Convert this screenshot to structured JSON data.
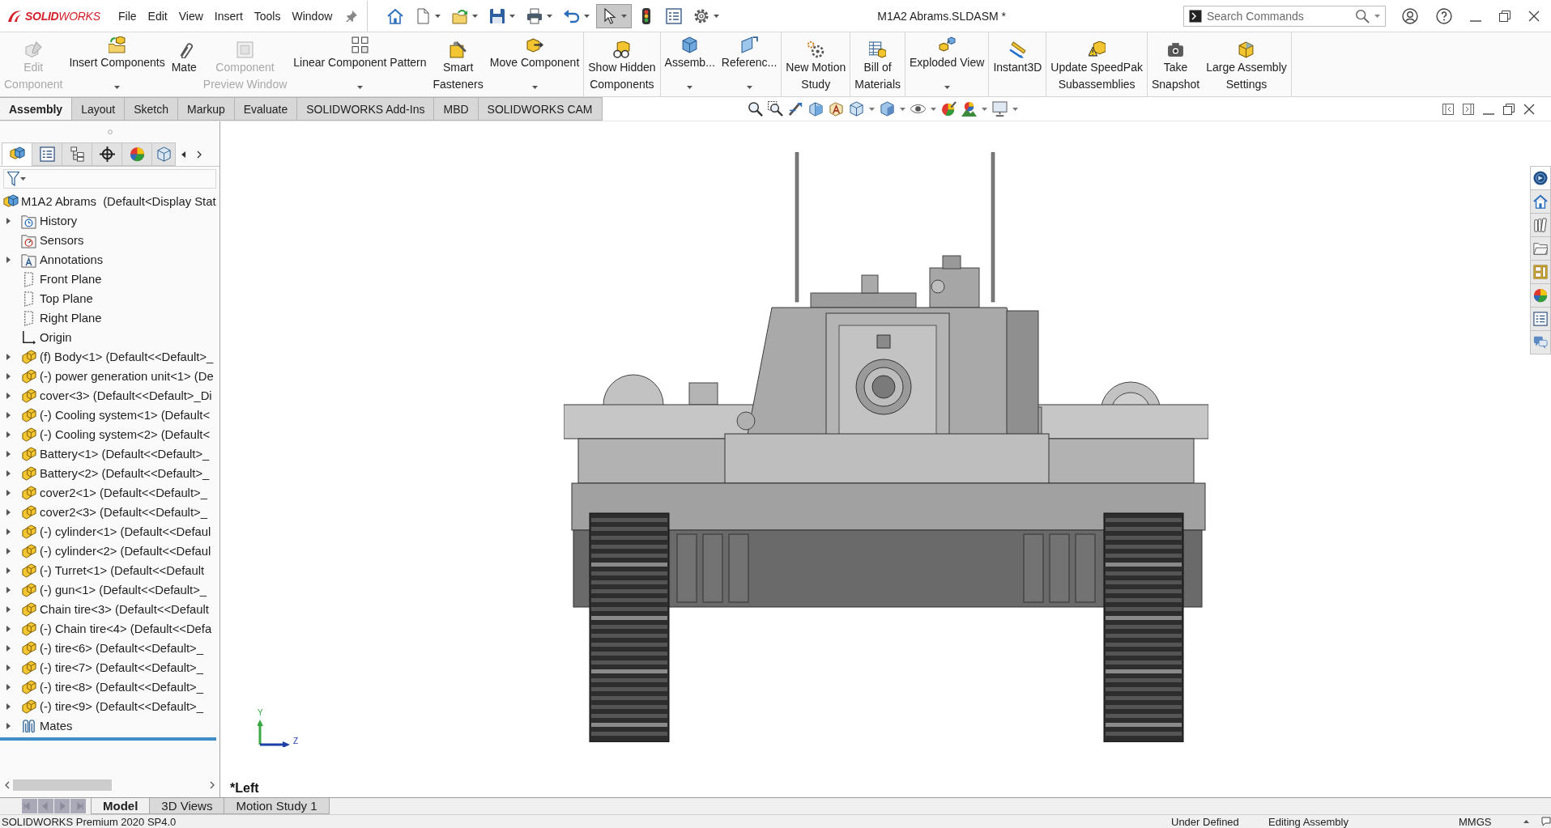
{
  "title_bar": {
    "logo": "**SOLID**WORKS",
    "menu": [
      "File",
      "Edit",
      "View",
      "Insert",
      "Tools",
      "Window"
    ],
    "quick_access": [
      {
        "dropdown": false,
        "selected": false
      },
      {
        "dropdown": true,
        "selected": false
      },
      {
        "dropdown": true,
        "selected": false
      },
      {
        "dropdown": true,
        "selected": false
      },
      {
        "dropdown": true,
        "selected": false
      },
      {
        "dropdown": true,
        "selected": false
      },
      {
        "dropdown": true,
        "selected": true
      },
      {
        "dropdown": false,
        "selected": false
      },
      {
        "dropdown": false,
        "selected": false
      },
      {
        "dropdown": true,
        "selected": false
      }
    ],
    "document_title": "M1A2 Abrams.SLDASM *",
    "search": {
      "placeholder": "Search Commands"
    }
  },
  "ribbon": {
    "groups": [
      {
        "buttons": [
          {
            "lines": [
              "Edit",
              "Component"
            ],
            "disabled": true,
            "dropdown": false
          },
          {
            "lines": [
              "Insert Components"
            ],
            "disabled": false,
            "dropdown": true
          },
          {
            "lines": [
              "Mate"
            ],
            "disabled": false,
            "dropdown": false
          },
          {
            "lines": [
              "Component",
              "Preview Window"
            ],
            "disabled": true,
            "dropdown": false
          },
          {
            "lines": [
              "Linear Component Pattern"
            ],
            "disabled": false,
            "dropdown": true
          },
          {
            "lines": [
              "Smart",
              "Fasteners"
            ],
            "disabled": false,
            "dropdown": false
          },
          {
            "lines": [
              "Move Component"
            ],
            "disabled": false,
            "dropdown": true
          }
        ]
      },
      {
        "buttons": [
          {
            "lines": [
              "Show Hidden",
              "Components"
            ],
            "disabled": false,
            "dropdown": false
          }
        ]
      },
      {
        "buttons": [
          {
            "lines": [
              "Assemb..."
            ],
            "disabled": false,
            "dropdown": true
          },
          {
            "lines": [
              "Referenc..."
            ],
            "disabled": false,
            "dropdown": true
          }
        ]
      },
      {
        "buttons": [
          {
            "lines": [
              "New Motion",
              "Study"
            ],
            "disabled": false,
            "dropdown": false
          }
        ]
      },
      {
        "buttons": [
          {
            "lines": [
              "Bill of",
              "Materials"
            ],
            "disabled": false,
            "dropdown": false
          }
        ]
      },
      {
        "buttons": [
          {
            "lines": [
              "Exploded View"
            ],
            "disabled": false,
            "dropdown": true
          }
        ]
      },
      {
        "buttons": [
          {
            "lines": [
              "Instant3D"
            ],
            "disabled": false,
            "dropdown": false
          }
        ]
      },
      {
        "buttons": [
          {
            "lines": [
              "Update SpeedPak",
              "Subassemblies"
            ],
            "disabled": false,
            "dropdown": false
          }
        ]
      },
      {
        "buttons": [
          {
            "lines": [
              "Take",
              "Snapshot"
            ],
            "disabled": false,
            "dropdown": false
          },
          {
            "lines": [
              "Large Assembly",
              "Settings"
            ],
            "disabled": false,
            "dropdown": false
          }
        ]
      }
    ]
  },
  "command_tabs": [
    {
      "label": "Assembly",
      "selected": true
    },
    {
      "label": "Layout",
      "selected": false
    },
    {
      "label": "Sketch",
      "selected": false
    },
    {
      "label": "Markup",
      "selected": false
    },
    {
      "label": "Evaluate",
      "selected": false
    },
    {
      "label": "SOLIDWORKS Add-Ins",
      "selected": false
    },
    {
      "label": "MBD",
      "selected": false
    },
    {
      "label": "SOLIDWORKS CAM",
      "selected": false
    }
  ],
  "feature_manager": {
    "tabs": [
      {
        "selected": true
      },
      {
        "selected": false
      },
      {
        "selected": false
      },
      {
        "selected": false
      },
      {
        "selected": false
      },
      {
        "selected": false
      }
    ],
    "tree": {
      "label": "M1A2 Abrams  (Default<Display Stat",
      "kind": "assembly",
      "children": [
        {
          "label": "History",
          "kind": "history",
          "expanded": false
        },
        {
          "label": "Sensors",
          "kind": "sensors"
        },
        {
          "label": "Annotations",
          "kind": "annotations",
          "expanded": false
        },
        {
          "label": "Front Plane",
          "kind": "plane"
        },
        {
          "label": "Top Plane",
          "kind": "plane"
        },
        {
          "label": "Right Plane",
          "kind": "plane"
        },
        {
          "label": "Origin",
          "kind": "origin"
        },
        {
          "label": "(f) Body<1> (Default<<Default>_",
          "kind": "part",
          "expanded": false
        },
        {
          "label": "(-) power generation unit<1> (De",
          "kind": "part",
          "expanded": false
        },
        {
          "label": "cover<3> (Default<<Default>_Di",
          "kind": "part",
          "expanded": false
        },
        {
          "label": "(-) Cooling system<1> (Default<",
          "kind": "part",
          "expanded": false
        },
        {
          "label": "(-) Cooling system<2> (Default<",
          "kind": "part",
          "expanded": false
        },
        {
          "label": "Battery<1> (Default<<Default>_",
          "kind": "part",
          "expanded": false
        },
        {
          "label": "Battery<2> (Default<<Default>_",
          "kind": "part",
          "expanded": false
        },
        {
          "label": "cover2<1> (Default<<Default>_",
          "kind": "part",
          "expanded": false
        },
        {
          "label": "cover2<3> (Default<<Default>_",
          "kind": "part",
          "expanded": false
        },
        {
          "label": "(-) cylinder<1> (Default<<Defaul",
          "kind": "part",
          "expanded": false
        },
        {
          "label": "(-) cylinder<2> (Default<<Defaul",
          "kind": "part",
          "expanded": false
        },
        {
          "label": "(-) Turret<1> (Default<<Default",
          "kind": "part",
          "expanded": false
        },
        {
          "label": "(-) gun<1> (Default<<Default>_",
          "kind": "part",
          "expanded": false
        },
        {
          "label": "Chain tire<3> (Default<<Default",
          "kind": "part",
          "expanded": false
        },
        {
          "label": "(-) Chain tire<4> (Default<<Defa",
          "kind": "part",
          "expanded": false
        },
        {
          "label": "(-) tire<6> (Default<<Default>_",
          "kind": "part",
          "expanded": false
        },
        {
          "label": "(-) tire<7> (Default<<Default>_",
          "kind": "part",
          "expanded": false
        },
        {
          "label": "(-) tire<8> (Default<<Default>_",
          "kind": "part",
          "expanded": false
        },
        {
          "label": "(-) tire<9> (Default<<Default>_",
          "kind": "part",
          "expanded": false
        },
        {
          "label": "Mates",
          "kind": "mates",
          "expanded": false
        }
      ]
    }
  },
  "viewport": {
    "view_label": "*Left",
    "triad": {
      "y_label": "Y",
      "z_label": "Z"
    },
    "task_pane": [
      {
        "selected": true
      },
      {
        "selected": false
      },
      {
        "selected": false
      },
      {
        "selected": false
      },
      {
        "selected": false
      },
      {
        "selected": false
      },
      {
        "selected": false
      },
      {
        "selected": false
      }
    ]
  },
  "bottom_tabs": [
    {
      "label": "Model",
      "selected": true
    },
    {
      "label": "3D Views",
      "selected": false
    },
    {
      "label": "Motion Study 1",
      "selected": false
    }
  ],
  "status_bar": {
    "product": "SOLIDWORKS Premium 2020 SP4.0",
    "state": "Under Defined",
    "mode": "Editing Assembly",
    "units": "MMGS"
  }
}
